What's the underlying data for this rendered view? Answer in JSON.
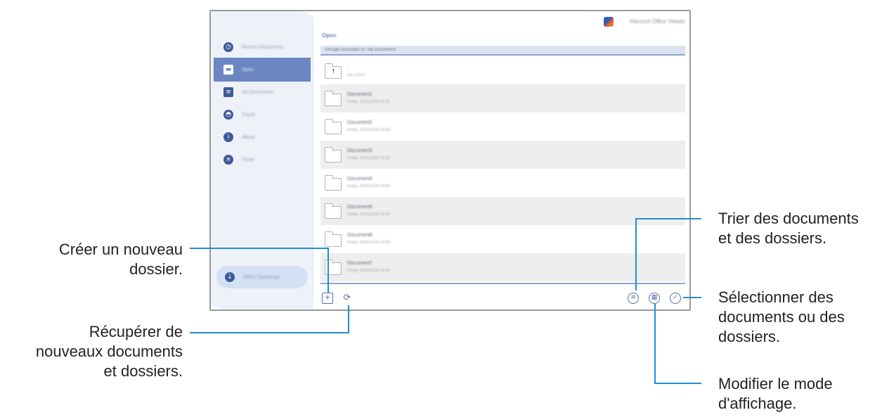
{
  "app": {
    "name": "Hancom Office Viewer",
    "logo_colors": [
      "#2f5fb5",
      "#d9473b",
      "#e6a23c"
    ]
  },
  "sidebar": {
    "items": [
      {
        "label": "Recent Documents",
        "icon": "clock-icon"
      },
      {
        "label": "Open",
        "icon": "folder-open-icon",
        "active": true
      },
      {
        "label": "All Documents",
        "icon": "documents-icon"
      },
      {
        "label": "Cloud",
        "icon": "cloud-icon"
      },
      {
        "label": "About",
        "icon": "info-icon"
      },
      {
        "label": "Close",
        "icon": "close-icon"
      }
    ],
    "download_label": "Office Download"
  },
  "main": {
    "title": "Open",
    "path": "Storage (emulated 0) / My Documents",
    "up_row": {
      "name": "..",
      "sub": "Up a level"
    },
    "rows": [
      {
        "name": "Document1",
        "date": "Friday, 2015/12/31 00:00"
      },
      {
        "name": "Document2",
        "date": "Friday, 2015/12/31 00:00"
      },
      {
        "name": "Document3",
        "date": "Friday, 2015/12/31 00:00"
      },
      {
        "name": "Document4",
        "date": "Friday, 2015/12/31 00:00"
      },
      {
        "name": "Document5",
        "date": "Friday, 2015/12/31 00:00"
      },
      {
        "name": "Document6",
        "date": "Friday, 2015/12/31 00:00"
      },
      {
        "name": "Document7",
        "date": "Friday, 2015/12/31 00:00"
      }
    ]
  },
  "toolbar": {
    "new_folder_icon": "folder-add-icon",
    "refresh_icon": "refresh-icon",
    "sort_icon": "sort-icon",
    "view_icon": "view-mode-icon",
    "select_icon": "select-check-icon"
  },
  "callouts": {
    "new_folder": [
      "Créer un nouveau",
      "dossier."
    ],
    "refresh": [
      "Récupérer de",
      "nouveaux documents",
      "et dossiers."
    ],
    "sort": [
      "Trier des documents",
      "et des dossiers."
    ],
    "select": [
      "Sélectionner des",
      "documents ou des",
      "dossiers."
    ],
    "view_mode": [
      "Modifier le mode",
      "d'affichage."
    ]
  },
  "colors": {
    "accent": "#6b86c3",
    "callout_line": "#1f8fd3",
    "row_shade": "#eeeeee"
  }
}
